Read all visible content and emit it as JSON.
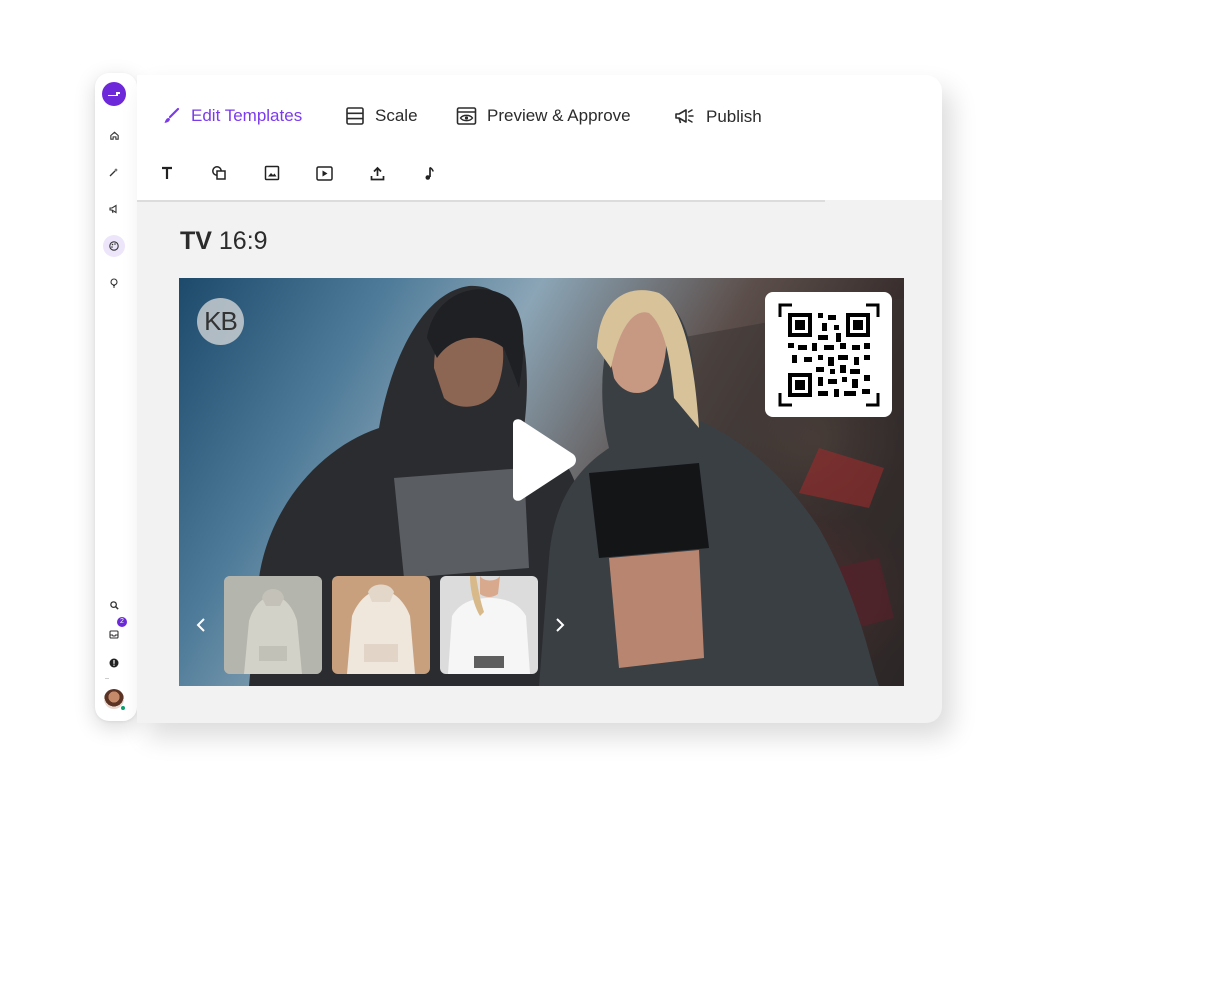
{
  "rail": {
    "items": [
      {
        "name": "home-icon"
      },
      {
        "name": "magic-wand-icon"
      },
      {
        "name": "megaphone-icon"
      },
      {
        "name": "palette-icon",
        "active": true
      },
      {
        "name": "lightbulb-icon"
      }
    ],
    "bottom": {
      "search": "search-icon",
      "inbox": "inbox-icon",
      "inbox_badge": "2",
      "help": "help-icon"
    }
  },
  "tabs": [
    {
      "label": "Edit Templates",
      "icon": "brush-icon",
      "active": true
    },
    {
      "label": "Scale",
      "icon": "layers-icon"
    },
    {
      "label": "Preview & Approve",
      "icon": "eye-window-icon"
    },
    {
      "label": "Publish",
      "icon": "megaphone-icon"
    }
  ],
  "tools": [
    {
      "name": "text-tool-icon"
    },
    {
      "name": "shapes-tool-icon"
    },
    {
      "name": "image-tool-icon"
    },
    {
      "name": "video-tool-icon"
    },
    {
      "name": "upload-tool-icon"
    },
    {
      "name": "audio-tool-icon"
    }
  ],
  "format": {
    "bold": "TV",
    "ratio": "16:9"
  },
  "canvas": {
    "brand_mark": "KB",
    "thumbnails": [
      "gray-hoodie",
      "beige-hoodie",
      "white-hoodie"
    ]
  },
  "colors": {
    "accent": "#7c3aed",
    "logo": "#6d28d9"
  }
}
